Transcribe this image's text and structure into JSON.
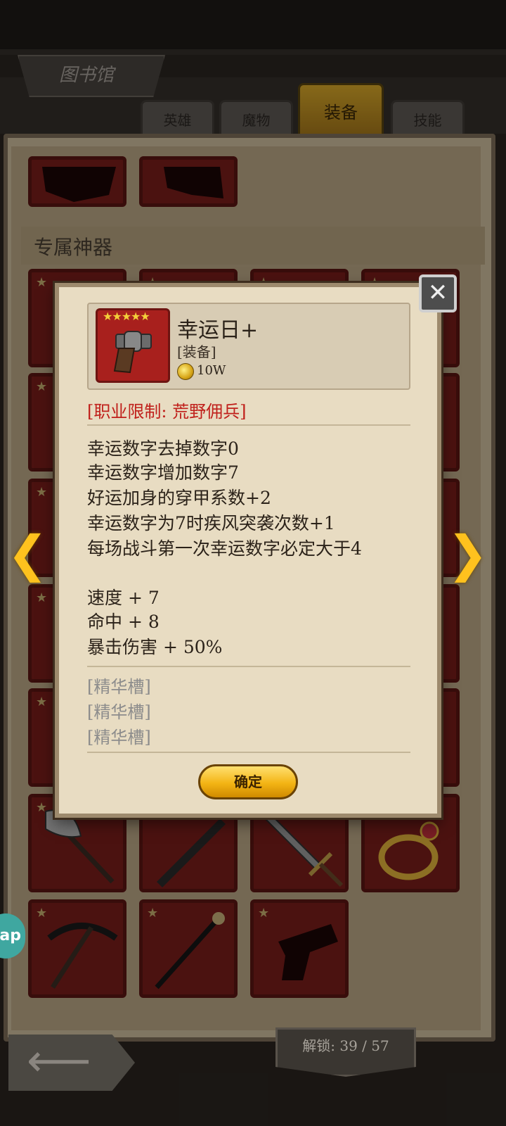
{
  "header": {
    "title": "图书馆"
  },
  "tabs": [
    {
      "label": "英雄",
      "active": false
    },
    {
      "label": "魔物",
      "active": false
    },
    {
      "label": "装备",
      "active": true
    },
    {
      "label": "技能",
      "active": false
    }
  ],
  "section": {
    "label": "专属神器"
  },
  "grid_icons": [
    "silhouette-icon",
    "silhouette-icon",
    "axe-icon",
    "sword-icon",
    "sword-icon",
    "ring-icon",
    "pickaxe-icon",
    "cane-icon",
    "silhouette-icon"
  ],
  "modal": {
    "item": {
      "name": "幸运日+",
      "type": "[装备]",
      "price": "10W",
      "star_count": 5,
      "icon": "revolver-icon"
    },
    "restriction": "[职业限制: 荒野佣兵]",
    "effects": [
      "幸运数字去掉数字0",
      "幸运数字增加数字7",
      "好运加身的穿甲系数+2",
      "幸运数字为7时疾风突袭次数+1",
      "每场战斗第一次幸运数字必定大于4"
    ],
    "stats": [
      "速度 + 7",
      "命中 + 8",
      "暴击伤害 + 50%"
    ],
    "slots": [
      "[精华槽]",
      "[精华槽]",
      "[精华槽]"
    ],
    "confirm_label": "确定",
    "close_icon": "close-icon"
  },
  "nav": {
    "prev_icon": "chevron-left-icon",
    "next_icon": "chevron-right-icon",
    "back_icon": "back-arrow-icon",
    "app_bubble": "ap"
  },
  "footer": {
    "unlock_text": "解锁: 39 / 57"
  },
  "colors": {
    "accent_gold": "#ffc21e",
    "restriction_red": "#c0201b",
    "card_red": "#7a1d1a",
    "slot_gray": "#8c8c8c"
  }
}
